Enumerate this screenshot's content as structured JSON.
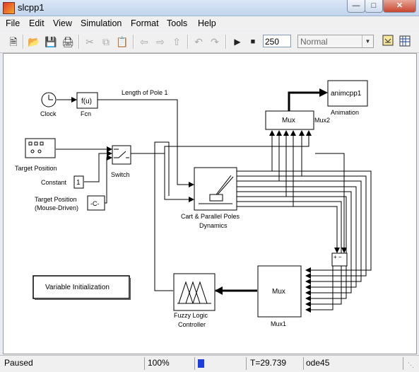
{
  "window": {
    "title": "slcpp1",
    "minimize": "—",
    "maximize": "□",
    "close": "✕"
  },
  "menu": [
    "File",
    "Edit",
    "View",
    "Simulation",
    "Format",
    "Tools",
    "Help"
  ],
  "toolbar": {
    "icons": [
      "new-icon",
      "open-icon",
      "save-icon",
      "print-icon",
      "cut-icon",
      "copy-icon",
      "paste-icon",
      "back-icon",
      "forward-icon",
      "up-icon",
      "undo-icon",
      "redo-icon",
      "play-icon",
      "stop-icon"
    ],
    "stop_time": "250",
    "sim_mode": "Normal"
  },
  "blocks": {
    "clock": "Clock",
    "fcn_body": "f(u)",
    "fcn": "Fcn",
    "pole_length": "Length of Pole 1",
    "mux2_body": "Mux",
    "mux2": "Mux2",
    "anim_body": "animcpp1",
    "animation": "Animation",
    "target_position": "Target Position",
    "switch": "Switch",
    "constant_body": "1",
    "constant": "Constant",
    "target_mouse_line1": "Target Position",
    "target_mouse_line2": "(Mouse-Driven)",
    "c_body": "-C-",
    "cart_line1": "Cart & Parallel Poles",
    "cart_line2": "Dynamics",
    "sum_body": "+ −",
    "varinit": "Variable Initialization",
    "mux1_body": "Mux",
    "mux1": "Mux1",
    "fuzzy_line1": "Fuzzy Logic",
    "fuzzy_line2": "Controller"
  },
  "status": {
    "state": "Paused",
    "zoom": "100%",
    "progress": 0.05,
    "time": "T=29.739",
    "solver": "ode45"
  }
}
